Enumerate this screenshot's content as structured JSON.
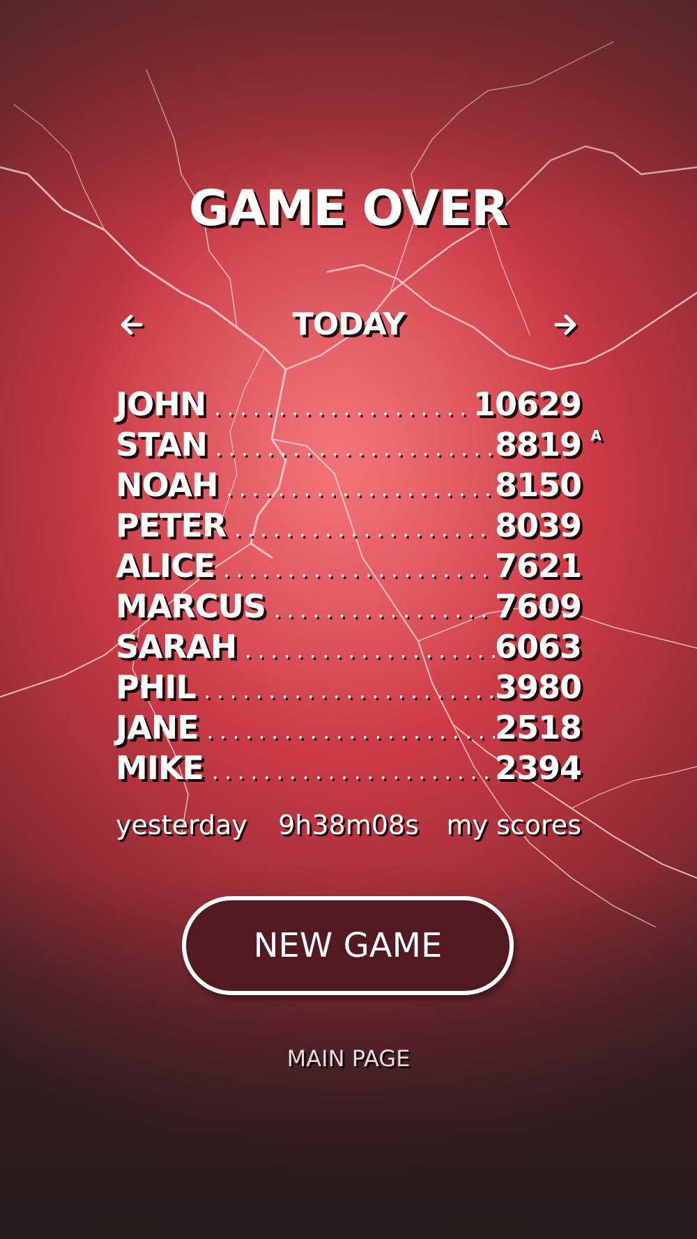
{
  "screen": {
    "title": "GAME OVER",
    "period": "TODAY",
    "prev_icon": "arrow-left-icon",
    "next_icon": "arrow-right-icon"
  },
  "leaderboard": [
    {
      "name": "JOHN",
      "score": "10629",
      "mark": ""
    },
    {
      "name": "STAN",
      "score": "8819",
      "mark": "A"
    },
    {
      "name": "NOAH",
      "score": "8150",
      "mark": ""
    },
    {
      "name": "PETER",
      "score": "8039",
      "mark": ""
    },
    {
      "name": "ALICE",
      "score": "7621",
      "mark": ""
    },
    {
      "name": "MARCUS",
      "score": "7609",
      "mark": ""
    },
    {
      "name": "SARAH",
      "score": "6063",
      "mark": ""
    },
    {
      "name": "PHIL",
      "score": "3980",
      "mark": ""
    },
    {
      "name": "JANE",
      "score": "2518",
      "mark": ""
    },
    {
      "name": "MIKE",
      "score": "2394",
      "mark": ""
    }
  ],
  "footer": {
    "yesterday": "yesterday",
    "timer": "9h38m08s",
    "my_scores": "my scores"
  },
  "buttons": {
    "new_game": "NEW GAME",
    "main_page": "MAIN PAGE"
  },
  "colors": {
    "background": "#c23b45",
    "button_fill": "#521a20",
    "text": "#ffffff"
  }
}
